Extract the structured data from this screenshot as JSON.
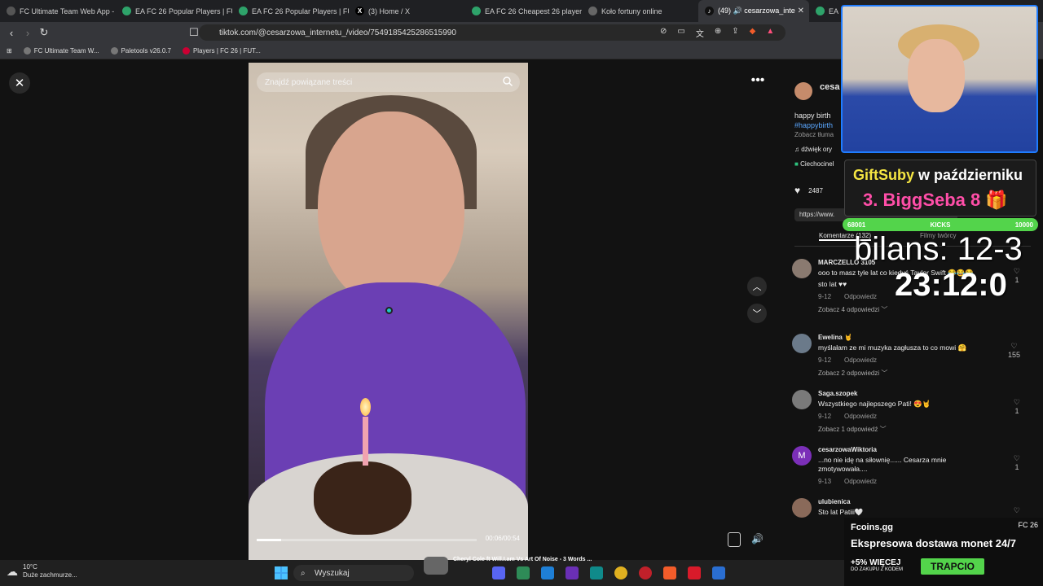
{
  "tabs": [
    {
      "label": "FC Ultimate Team Web App - E",
      "color": "#3a3a3a"
    },
    {
      "label": "EA FC 26 Popular Players | FUT",
      "color": "#2ea36a"
    },
    {
      "label": "EA FC 26 Popular Players | FUT",
      "color": "#2ea36a"
    },
    {
      "label": "(3) Home / X",
      "color": "#000000"
    },
    {
      "label": "EA FC 26 Cheapest 26 players",
      "color": "#2ea36a"
    },
    {
      "label": "Koło fortuny online",
      "color": "#3a3a3a"
    },
    {
      "label": "(49) 🔊 cesarzowa_inte",
      "color": "#111111",
      "active": true
    },
    {
      "label": "EA",
      "color": "#2ea36a"
    }
  ],
  "address": {
    "url": "tiktok.com/@cesarzowa_internetu_/video/7549185425286515990"
  },
  "bookmarks": [
    "FC Ultimate Team W...",
    "Paletools v26.0.7",
    "Players | FC 26 | FUT..."
  ],
  "video": {
    "search_placeholder": "Znajdź powiązane treści",
    "time": "00:06/00:54",
    "progress": 0.11
  },
  "post": {
    "author": "cesa",
    "caption": "happy birth",
    "hashtag": "#happybirth",
    "translate": "Zobacz tłuma",
    "sound": "dźwięk ory",
    "location": "Ciechocinel",
    "likes": "2487",
    "url": "https://www.",
    "tab_comments": "Komentarze (132)",
    "tab_creator": "Filmy twórcy"
  },
  "comments": [
    {
      "name": "MARCZELLO 3105",
      "text": "ooo to masz tyle lat co kiedyś Taylor Swift 😂😂😂",
      "reply": "sto lat ♥♥",
      "date": "9-12",
      "reply_label": "Odpowiedz",
      "more": "Zobacz 4 odpowiedzi",
      "likes": "1"
    },
    {
      "name": "Ewelina 🤘",
      "text": "myślałam ze mi muzyka zagłusza to co mowi 🤗",
      "date": "9-12",
      "reply_label": "Odpowiedz",
      "more": "Zobacz 2 odpowiedzi",
      "likes": "155"
    },
    {
      "name": "Saga.szopek",
      "text": "Wszystkiego najlepszego Pati! 😍🤘",
      "date": "9-12",
      "reply_label": "Odpowiedz",
      "more": "Zobacz 1 odpowiedź",
      "likes": "1"
    },
    {
      "name": "cesarzowaWiktoria",
      "text": "...no nie idę na siłownię...... Cesarza mnie zmotywowała....",
      "date": "9-13",
      "reply_label": "Odpowiedz",
      "more": "",
      "likes": "1"
    },
    {
      "name": "ulubienica",
      "text": "Sto lat Patiii🤍",
      "date": "",
      "reply_label": "",
      "more": "",
      "likes": ""
    }
  ],
  "overlay": {
    "gift_title": "GiftSuby",
    "gift_month": "w październiku",
    "gift_rank": "3. BiggSeba 8 🎁",
    "kicks_left": "68001",
    "kicks_label": "KICKS",
    "kicks_right": "10000",
    "bilans": "bilans: 12-3",
    "clock": "23:12:0"
  },
  "ad": {
    "brand": "Fcoins.gg",
    "game": "FC 26",
    "headline": "Ekspresowa dostawa monet 24/7",
    "pct": "+5% WIĘCEJ",
    "pct_sub": "DO ZAKUPU Z KODEM",
    "code": "TRAPCIO"
  },
  "taskbar": {
    "temp": "10°C",
    "weather": "Duże zachmurze...",
    "search": "Wyszukaj",
    "music": "Cheryl Cole ft Will.I.am Vs Art Of Noise - 3 Words ..."
  }
}
